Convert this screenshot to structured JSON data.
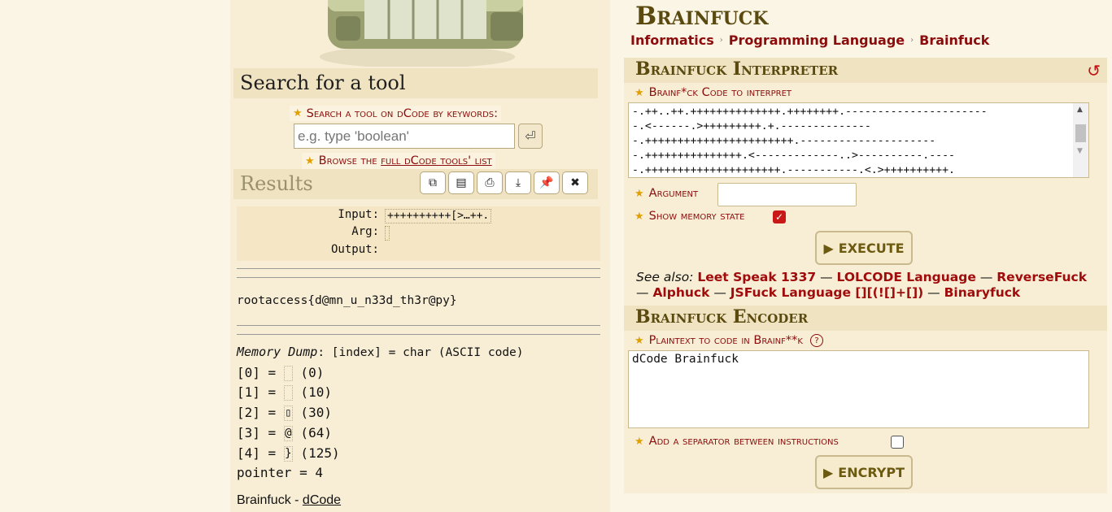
{
  "search": {
    "title": "Search for a tool",
    "tip": "Search a tool on dCode by keywords:",
    "placeholder": "e.g. type 'boolean'",
    "browse_prefix": "Browse the ",
    "browse_link": "full dCode tools' list"
  },
  "results": {
    "title": "Results",
    "input_label": "Input:",
    "input_value": "++++++++++[>…++.",
    "arg_label": "Arg:",
    "output_label": "Output:",
    "output_text": "rootaccess{d@mn_u_n33d_th3r@py}",
    "memory_title": "Memory Dump",
    "memory_note": ": [index] = char (ASCII code)",
    "memory": [
      {
        "index": "[0] = ",
        "char": "",
        "code": " (0)"
      },
      {
        "index": "[1] = ",
        "char": "",
        "code": " (10)"
      },
      {
        "index": "[2] = ",
        "char": "▯",
        "code": " (30)"
      },
      {
        "index": "[3] = ",
        "char": "@",
        "code": " (64)"
      },
      {
        "index": "[4] = ",
        "char": "}",
        "code": " (125)"
      }
    ],
    "pointer": "pointer = 4",
    "footer_prefix": "Brainfuck - ",
    "footer_link": "dCode"
  },
  "toolbar_icons": [
    "copy-icon",
    "save-icon",
    "print-icon",
    "download-icon",
    "pin-icon",
    "close-icon"
  ],
  "page": {
    "title": "Brainfuck",
    "breadcrumbs": [
      "Informatics",
      "Programming Language",
      "Brainfuck"
    ]
  },
  "interpreter": {
    "title": "Brainfuck Interpreter",
    "code_label": "Brainf*ck Code to interpret",
    "code_text": "-.++..++.++++++++++++++.++++++++.----------------------\n-.<------.>+++++++++.+.--------------\n-.+++++++++++++++++++++++.---------------------\n-.+++++++++++++++.<-------------..>----------.----\n-.+++++++++++++++++++++.-----------.<.>++++++++++.\n<++++++++++++.>--.+++++++++.++++.",
    "argument_label": "Argument",
    "memory_label": "Show memory state",
    "execute_label": "EXECUTE",
    "see_also_label": "See also:",
    "see_also": [
      "Leet Speak 1337",
      "LOLCODE Language",
      "ReverseFuck",
      "Alphuck",
      "JSFuck Language [][(![]+[])",
      "Binaryfuck"
    ]
  },
  "encoder": {
    "title": "Brainfuck Encoder",
    "plaintext_label": "Plaintext to code in Brainf**k",
    "help": "?",
    "plaintext": "dCode Brainfuck",
    "separator_label": "Add a separator between instructions",
    "encrypt_label": "ENCRYPT"
  }
}
